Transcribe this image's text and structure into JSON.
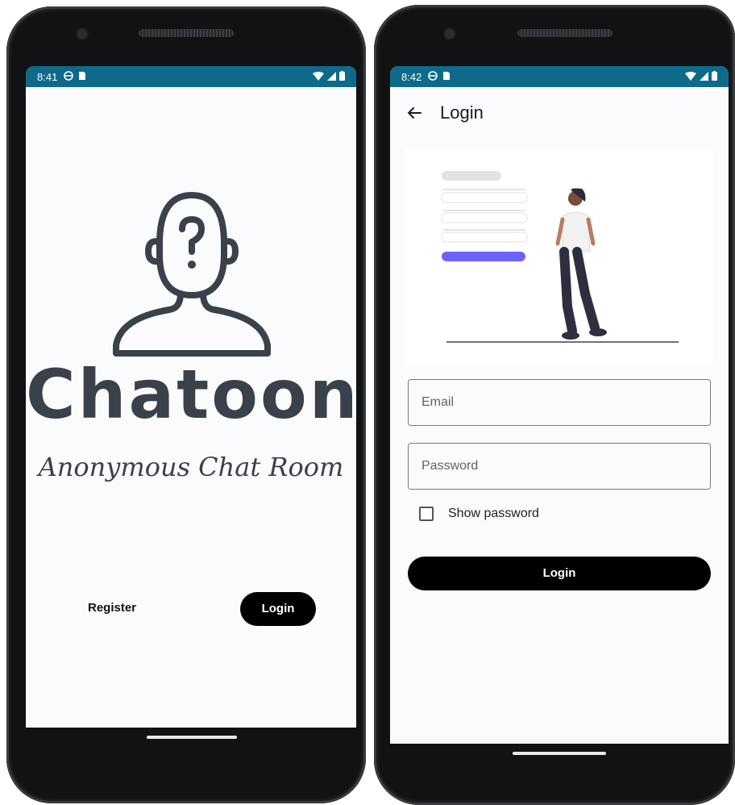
{
  "left_screen": {
    "statusbar": {
      "time": "8:41",
      "icons": [
        "vpn-globe-icon",
        "sim-card-icon",
        "wifi-icon",
        "signal-icon",
        "battery-icon"
      ]
    },
    "avatar_icon": "anonymous-person-question-icon",
    "brand_title": "Chatoon",
    "tagline": "Anonymous Chat Room",
    "register_label": "Register",
    "login_label": "Login"
  },
  "right_screen": {
    "statusbar": {
      "time": "8:42",
      "icons": [
        "vpn-globe-icon",
        "sim-card-icon",
        "wifi-icon",
        "signal-icon",
        "battery-icon"
      ]
    },
    "appbar": {
      "back_icon": "arrow-back-icon",
      "title": "Login"
    },
    "illustration": "woman-standing-beside-login-form-illustration",
    "email": {
      "placeholder": "Email",
      "value": ""
    },
    "password": {
      "placeholder": "Password",
      "value": ""
    },
    "show_password_label": "Show password",
    "show_password_checked": false,
    "login_label": "Login"
  },
  "colors": {
    "statusbar": "#0e6a8a",
    "brand_text": "#3a414b",
    "button_bg": "#000000",
    "button_text": "#ffffff",
    "illustration_accent": "#6c63ff"
  }
}
